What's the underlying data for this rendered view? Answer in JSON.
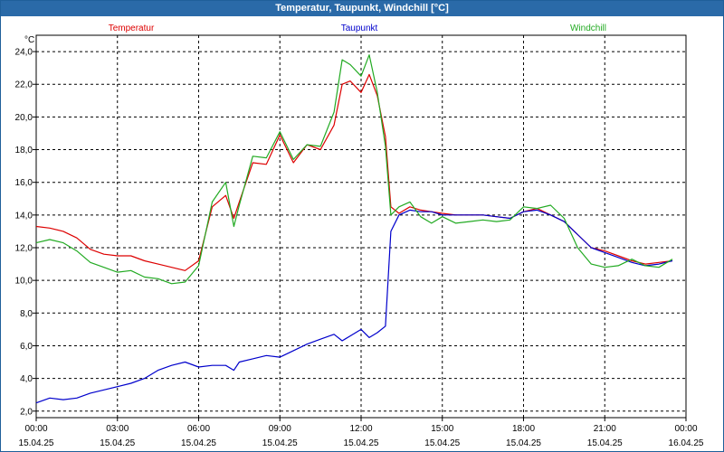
{
  "window": {
    "title": "Temperatur, Taupunkt, Windchill [°C]"
  },
  "chart_data": {
    "type": "line",
    "title": "Temperatur, Taupunkt, Windchill [°C]",
    "ylabel": "°C",
    "xlabel": "",
    "ylim": [
      1.6,
      25.0
    ],
    "xlim_hours": [
      0,
      24
    ],
    "grid": true,
    "legend_placement": "top",
    "y_ticks": [
      "24,0",
      "22,0",
      "20,0",
      "18,0",
      "16,0",
      "14,0",
      "12,0",
      "10,0",
      "8,0",
      "6,0",
      "4,0",
      "2,0"
    ],
    "x_ticks": [
      {
        "time": "00:00",
        "date": "15.04.25"
      },
      {
        "time": "03:00",
        "date": "15.04.25"
      },
      {
        "time": "06:00",
        "date": "15.04.25"
      },
      {
        "time": "09:00",
        "date": "15.04.25"
      },
      {
        "time": "12:00",
        "date": "15.04.25"
      },
      {
        "time": "15:00",
        "date": "15.04.25"
      },
      {
        "time": "18:00",
        "date": "15.04.25"
      },
      {
        "time": "21:00",
        "date": "15.04.25"
      },
      {
        "time": "00:00",
        "date": "16.04.25"
      }
    ],
    "series": [
      {
        "name": "Temperatur",
        "color": "#dd0000",
        "points": [
          [
            0,
            13.3
          ],
          [
            0.5,
            13.2
          ],
          [
            1,
            13.0
          ],
          [
            1.5,
            12.6
          ],
          [
            2,
            11.9
          ],
          [
            2.5,
            11.6
          ],
          [
            3,
            11.5
          ],
          [
            3.5,
            11.5
          ],
          [
            4,
            11.2
          ],
          [
            4.5,
            11.0
          ],
          [
            5,
            10.8
          ],
          [
            5.5,
            10.6
          ],
          [
            6,
            11.2
          ],
          [
            6.5,
            14.5
          ],
          [
            7,
            15.2
          ],
          [
            7.3,
            13.8
          ],
          [
            7.5,
            14.8
          ],
          [
            8,
            17.2
          ],
          [
            8.5,
            17.1
          ],
          [
            9,
            18.9
          ],
          [
            9.5,
            17.2
          ],
          [
            10,
            18.3
          ],
          [
            10.5,
            18.0
          ],
          [
            11,
            19.5
          ],
          [
            11.3,
            22.0
          ],
          [
            11.6,
            22.2
          ],
          [
            12,
            21.5
          ],
          [
            12.3,
            22.6
          ],
          [
            12.6,
            21.3
          ],
          [
            12.9,
            18.8
          ],
          [
            13.1,
            14.5
          ],
          [
            13.4,
            14.1
          ],
          [
            13.8,
            14.5
          ],
          [
            14.2,
            14.3
          ],
          [
            14.6,
            14.2
          ],
          [
            15,
            14.1
          ],
          [
            15.5,
            14.0
          ],
          [
            16,
            14.0
          ],
          [
            16.5,
            14.0
          ],
          [
            17,
            13.9
          ],
          [
            17.5,
            13.8
          ],
          [
            18,
            14.2
          ],
          [
            18.5,
            14.4
          ],
          [
            19,
            14.0
          ],
          [
            19.5,
            13.6
          ],
          [
            20,
            12.8
          ],
          [
            20.5,
            12.0
          ],
          [
            21,
            11.8
          ],
          [
            21.5,
            11.5
          ],
          [
            22,
            11.2
          ],
          [
            22.5,
            11.0
          ],
          [
            23,
            11.1
          ],
          [
            23.5,
            11.2
          ]
        ]
      },
      {
        "name": "Taupunkt",
        "color": "#0000cc",
        "points": [
          [
            0,
            2.5
          ],
          [
            0.5,
            2.8
          ],
          [
            1,
            2.7
          ],
          [
            1.5,
            2.8
          ],
          [
            2,
            3.1
          ],
          [
            2.5,
            3.3
          ],
          [
            3,
            3.5
          ],
          [
            3.5,
            3.7
          ],
          [
            4,
            4.0
          ],
          [
            4.5,
            4.5
          ],
          [
            5,
            4.8
          ],
          [
            5.5,
            5.0
          ],
          [
            6,
            4.7
          ],
          [
            6.5,
            4.8
          ],
          [
            7,
            4.8
          ],
          [
            7.3,
            4.5
          ],
          [
            7.5,
            5.0
          ],
          [
            8,
            5.2
          ],
          [
            8.5,
            5.4
          ],
          [
            9,
            5.3
          ],
          [
            9.5,
            5.7
          ],
          [
            10,
            6.1
          ],
          [
            10.5,
            6.4
          ],
          [
            11,
            6.7
          ],
          [
            11.3,
            6.3
          ],
          [
            11.6,
            6.6
          ],
          [
            12,
            7.0
          ],
          [
            12.3,
            6.5
          ],
          [
            12.6,
            6.8
          ],
          [
            12.9,
            7.2
          ],
          [
            13.1,
            13.0
          ],
          [
            13.4,
            14.0
          ],
          [
            13.8,
            14.3
          ],
          [
            14.2,
            14.2
          ],
          [
            14.6,
            14.2
          ],
          [
            15,
            14.0
          ],
          [
            15.5,
            14.0
          ],
          [
            16,
            14.0
          ],
          [
            16.5,
            14.0
          ],
          [
            17,
            13.9
          ],
          [
            17.5,
            13.8
          ],
          [
            18,
            14.2
          ],
          [
            18.5,
            14.3
          ],
          [
            19,
            14.0
          ],
          [
            19.5,
            13.6
          ],
          [
            20,
            12.8
          ],
          [
            20.5,
            12.0
          ],
          [
            21,
            11.7
          ],
          [
            21.5,
            11.4
          ],
          [
            22,
            11.1
          ],
          [
            22.5,
            10.9
          ],
          [
            23,
            11.0
          ],
          [
            23.5,
            11.2
          ]
        ]
      },
      {
        "name": "Windchill",
        "color": "#22aa22",
        "points": [
          [
            0,
            12.3
          ],
          [
            0.5,
            12.5
          ],
          [
            1,
            12.3
          ],
          [
            1.5,
            11.8
          ],
          [
            2,
            11.1
          ],
          [
            2.5,
            10.8
          ],
          [
            3,
            10.5
          ],
          [
            3.5,
            10.6
          ],
          [
            4,
            10.2
          ],
          [
            4.5,
            10.1
          ],
          [
            5,
            9.8
          ],
          [
            5.5,
            9.9
          ],
          [
            6,
            10.9
          ],
          [
            6.5,
            14.8
          ],
          [
            7,
            16.0
          ],
          [
            7.3,
            13.3
          ],
          [
            7.5,
            14.6
          ],
          [
            8,
            17.6
          ],
          [
            8.5,
            17.5
          ],
          [
            9,
            19.1
          ],
          [
            9.5,
            17.4
          ],
          [
            10,
            18.3
          ],
          [
            10.5,
            18.2
          ],
          [
            11,
            20.3
          ],
          [
            11.3,
            23.5
          ],
          [
            11.6,
            23.2
          ],
          [
            12,
            22.5
          ],
          [
            12.3,
            23.8
          ],
          [
            12.6,
            21.5
          ],
          [
            12.9,
            18.2
          ],
          [
            13.1,
            14.0
          ],
          [
            13.4,
            14.5
          ],
          [
            13.8,
            14.8
          ],
          [
            14.2,
            13.9
          ],
          [
            14.6,
            13.5
          ],
          [
            15,
            13.9
          ],
          [
            15.5,
            13.5
          ],
          [
            16,
            13.6
          ],
          [
            16.5,
            13.7
          ],
          [
            17,
            13.6
          ],
          [
            17.5,
            13.7
          ],
          [
            18,
            14.5
          ],
          [
            18.5,
            14.4
          ],
          [
            19,
            14.6
          ],
          [
            19.5,
            13.8
          ],
          [
            20,
            12.0
          ],
          [
            20.5,
            11.0
          ],
          [
            21,
            10.8
          ],
          [
            21.5,
            10.9
          ],
          [
            22,
            11.3
          ],
          [
            22.5,
            10.9
          ],
          [
            23,
            10.8
          ],
          [
            23.5,
            11.3
          ]
        ]
      }
    ]
  }
}
